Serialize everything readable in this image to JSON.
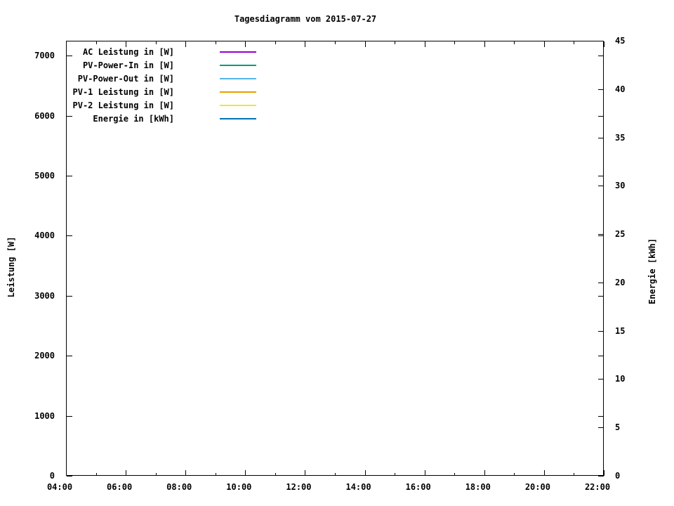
{
  "chart_data": {
    "type": "line",
    "title": "Tagesdiagramm vom 2015-07-27",
    "background_color": "#ffffff",
    "text_color": "#000000",
    "grid": false,
    "legend_position": "top-left-inside",
    "x_axis": {
      "min_hour": 4,
      "max_hour": 22,
      "major_step_hours": 2,
      "minor_step_hours": 1,
      "tick_labels": [
        "04:00",
        "06:00",
        "08:00",
        "10:00",
        "12:00",
        "14:00",
        "16:00",
        "18:00",
        "20:00",
        "22:00"
      ]
    },
    "y1_axis": {
      "label": "Leistung [W]",
      "min": 0,
      "max": 7250,
      "tick_step": 1000,
      "tick_labels": [
        "0",
        "1000",
        "2000",
        "3000",
        "4000",
        "5000",
        "6000",
        "7000"
      ]
    },
    "y2_axis": {
      "label": "Energie [kWh]",
      "min": 0,
      "max": 45,
      "tick_step": 5,
      "tick_labels": [
        "0",
        "5",
        "10",
        "15",
        "20",
        "25",
        "30",
        "35",
        "40",
        "45"
      ]
    },
    "legend": [
      {
        "label": "AC Leistung in [W]",
        "color": "#9400d3"
      },
      {
        "label": "PV-Power-In in [W]",
        "color": "#009e73"
      },
      {
        "label": "PV-Power-Out in [W]",
        "color": "#56b4e9"
      },
      {
        "label": "PV-1 Leistung in [W]",
        "color": "#e69f00"
      },
      {
        "label": "PV-2 Leistung in [W]",
        "color": "#f0e442"
      },
      {
        "label": "Energie in [kWh]",
        "color": "#0072b2"
      }
    ],
    "series": []
  }
}
